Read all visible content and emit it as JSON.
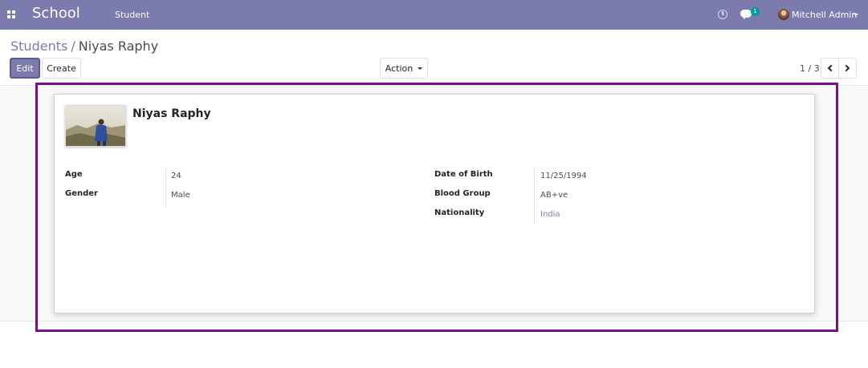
{
  "navbar": {
    "brand": "School",
    "menu_item": "Student",
    "chat_count": "1",
    "user_name": "Mitchell Admin"
  },
  "breadcrumb": {
    "parent": "Students",
    "separator": "/",
    "current": "Niyas Raphy"
  },
  "toolbar": {
    "edit_label": "Edit",
    "create_label": "Create",
    "action_label": "Action"
  },
  "pager": {
    "value": "1 / 3"
  },
  "record": {
    "name": "Niyas Raphy",
    "left_fields": [
      {
        "label": "Age",
        "value": "24"
      },
      {
        "label": "Gender",
        "value": "Male"
      }
    ],
    "right_fields": [
      {
        "label": "Date of Birth",
        "value": "11/25/1994"
      },
      {
        "label": "Blood Group",
        "value": "AB+ve"
      },
      {
        "label": "Nationality",
        "value": "India"
      }
    ]
  },
  "colors": {
    "navbar": "#7c7bad",
    "highlight_border": "#7b0f86",
    "link": "#7c7bad",
    "badge": "#00a09d"
  },
  "icons": [
    "apps-icon",
    "clock-icon",
    "chat-icon",
    "user-avatar",
    "chevron-left-icon",
    "chevron-right-icon",
    "caret-down-icon"
  ]
}
